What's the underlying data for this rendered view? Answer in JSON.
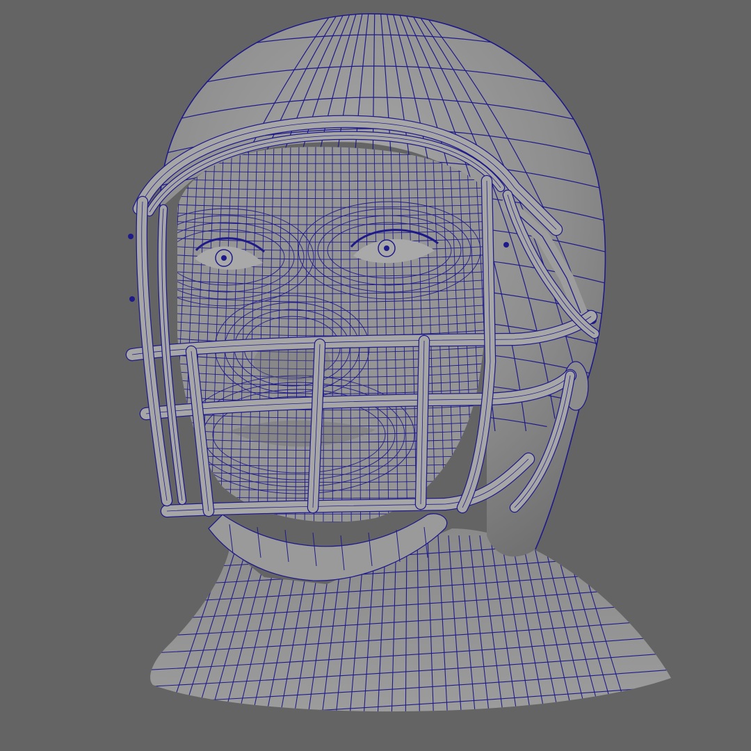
{
  "viewport": {
    "background": "#646464",
    "shade_color": "#8f8f8f",
    "shade_light": "#a3a3a3",
    "shade_dark": "#5a5a5a",
    "wire_color": "#1f1a8a",
    "render_mode": "wireframe-on-shaded"
  },
  "model": {
    "subject": "football-player-head-with-helmet-and-facemask"
  }
}
